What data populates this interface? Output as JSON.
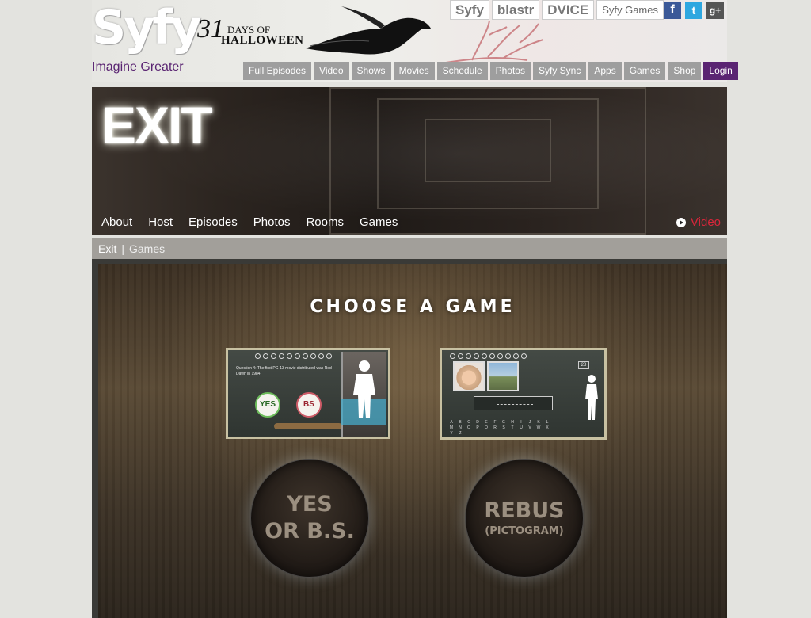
{
  "header": {
    "logo": "Syfy",
    "tagline": "Imagine Greater",
    "promo": {
      "number": "31",
      "line1": "DAYS OF",
      "line2": "HALLOWEEN"
    },
    "brands": [
      "Syfy",
      "blastr",
      "DVICE",
      "Syfy Games"
    ],
    "social": [
      {
        "icon": "facebook-icon",
        "glyph": "f",
        "color": "#3b5998"
      },
      {
        "icon": "twitter-icon",
        "glyph": "t",
        "color": "#2ea7e0"
      },
      {
        "icon": "google-plus-icon",
        "glyph": "g+",
        "color": "#555555"
      }
    ],
    "nav": [
      "Full Episodes",
      "Video",
      "Shows",
      "Movies",
      "Schedule",
      "Photos",
      "Syfy Sync",
      "Apps",
      "Games",
      "Shop"
    ],
    "login": "Login"
  },
  "hero": {
    "title": "EXIT",
    "tabs": [
      "About",
      "Host",
      "Episodes",
      "Photos",
      "Rooms",
      "Games"
    ],
    "video_label": "Video",
    "accent": "#d9263b"
  },
  "breadcrumb": {
    "home": "Exit",
    "sep": "|",
    "current": "Games"
  },
  "games": {
    "heading": "CHOOSE A GAME",
    "game1": {
      "question": "Question 4: The first PG-13 movie distributed was Red Dawn in 1984.",
      "yes": "YES",
      "bs": "BS",
      "title_l1": "YES",
      "title_l2": "OR B.S."
    },
    "game2": {
      "letters": [
        "A",
        "B",
        "C",
        "D",
        "E",
        "F",
        "G",
        "H",
        "I",
        "J",
        "K",
        "L",
        "M",
        "N",
        "O",
        "P",
        "Q",
        "R",
        "S",
        "T",
        "U",
        "V",
        "W",
        "X",
        "Y",
        "Z"
      ],
      "counter": "28",
      "title_l1": "REBUS",
      "title_l2": "(PICTOGRAM)"
    }
  }
}
